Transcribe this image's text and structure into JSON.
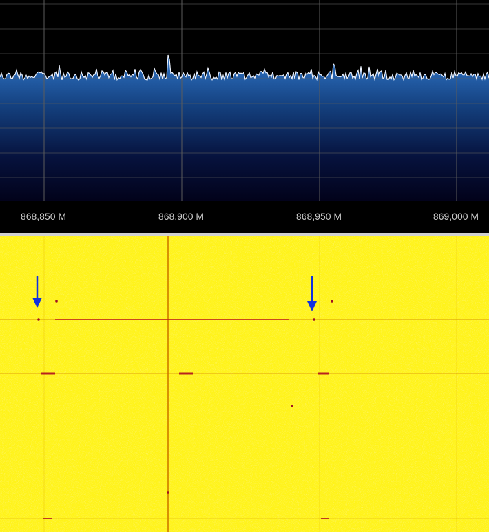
{
  "spectrum": {
    "frequency_labels": [
      "868,850 M",
      "868,900 M",
      "868,950 M",
      "869,000 M"
    ],
    "trace_color": "#e8f0ff",
    "fill_top_color": "#2a6cc0",
    "fill_bottom_color": "#020218",
    "grid_color": "#5a5a5a"
  },
  "waterfall": {
    "background_color": "#fff200",
    "signal_color": "#c0182a",
    "arrow_color": "#1030e0",
    "arrow_count": 2
  }
}
